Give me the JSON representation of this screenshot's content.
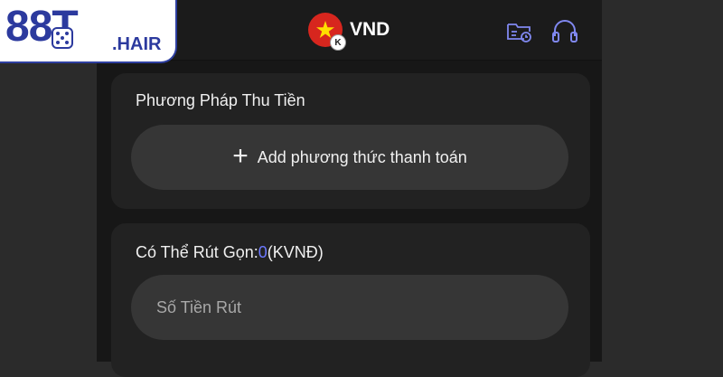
{
  "logo": {
    "main": "88T",
    "sub": ".HAIR",
    "color": "#2c3a9e"
  },
  "header": {
    "currency": "VND",
    "currency_badge": "K",
    "flag_icon": "vietnam-flag-icon",
    "icons": [
      "folder-clock-icon",
      "headset-icon"
    ]
  },
  "withdraw_method": {
    "title": "Phương Pháp Thu Tiền",
    "add_label": "Add phương thức thanh toán"
  },
  "withdraw_amount": {
    "title_prefix": "Có Thể Rút Gọn:",
    "available_value": "0",
    "title_suffix": "(KVNĐ)",
    "placeholder": "Số Tiền Rút"
  },
  "colors": {
    "accent": "#6c79ff",
    "background": "#2b2b2b",
    "card": "#222222"
  }
}
